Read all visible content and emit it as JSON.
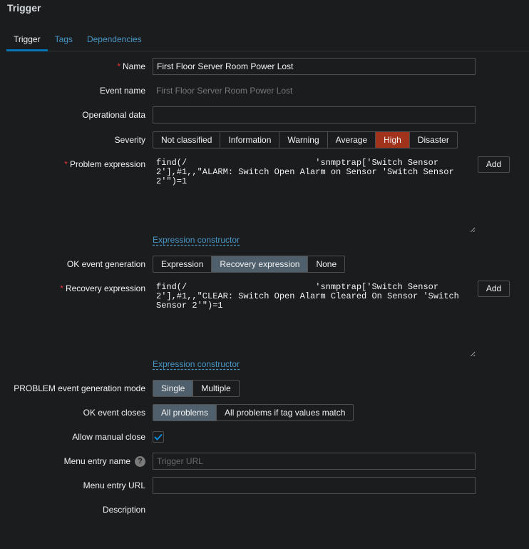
{
  "title": "Trigger",
  "tabs": [
    "Trigger",
    "Tags",
    "Dependencies"
  ],
  "form": {
    "name_label": "Name",
    "name_value": "First Floor Server Room Power Lost",
    "event_name_label": "Event name",
    "event_name_value": "First Floor Server Room Power Lost",
    "opdata_label": "Operational data",
    "opdata_value": "",
    "severity_label": "Severity",
    "severity_options": [
      "Not classified",
      "Information",
      "Warning",
      "Average",
      "High",
      "Disaster"
    ],
    "severity_selected": "High",
    "problem_expr_label": "Problem expression",
    "problem_expr_value": "find(/                         'snmptrap['Switch Sensor 2'],#1,,\"ALARM: Switch Open Alarm on Sensor 'Switch Sensor 2'\")=1",
    "add_label": "Add",
    "expr_constructor": "Expression constructor",
    "ok_gen_label": "OK event generation",
    "ok_gen_options": [
      "Expression",
      "Recovery expression",
      "None"
    ],
    "ok_gen_selected": "Recovery expression",
    "recovery_expr_label": "Recovery expression",
    "recovery_expr_value": "find(/                         'snmptrap['Switch Sensor 2'],#1,,\"CLEAR: Switch Open Alarm Cleared On Sensor 'Switch Sensor 2'\")=1",
    "problem_mode_label": "PROBLEM event generation mode",
    "problem_mode_options": [
      "Single",
      "Multiple"
    ],
    "ok_closes_label": "OK event closes",
    "ok_closes_options": [
      "All problems",
      "All problems if tag values match"
    ],
    "manual_close_label": "Allow manual close",
    "manual_close_checked": true,
    "menu_name_label": "Menu entry name",
    "menu_name_placeholder": "Trigger URL",
    "help_glyph": "?",
    "menu_url_label": "Menu entry URL",
    "menu_url_value": "",
    "description_label": "Description"
  },
  "colors": {
    "accent": "#0275b8",
    "link": "#4796c4",
    "high": "#a1331c",
    "selected": "#4f5f6b",
    "required": "#e33734"
  }
}
